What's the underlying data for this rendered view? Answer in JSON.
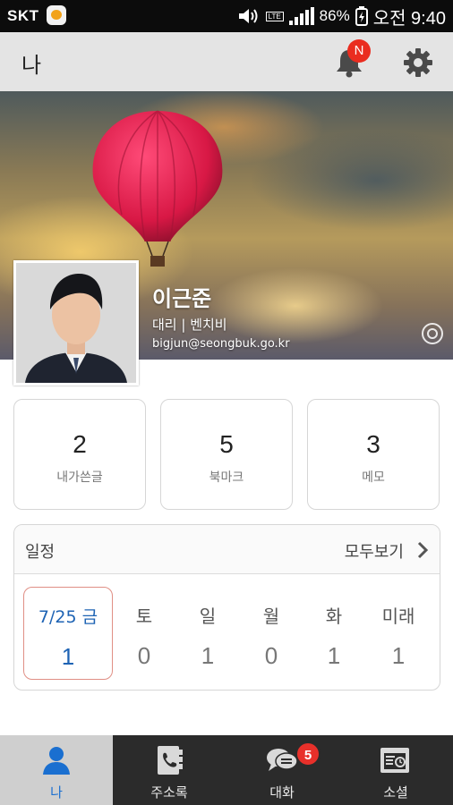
{
  "status_bar": {
    "carrier": "SKT",
    "network": "LTE",
    "battery_percent": "86%",
    "time": "오전 9:40",
    "icons": [
      "kakaotalk-icon",
      "volume-icon",
      "lte-icon",
      "signal-icon",
      "battery-charging-icon"
    ]
  },
  "app_bar": {
    "title": "나",
    "notification_badge": "N",
    "icons": [
      "bell-icon",
      "settings-gear-icon"
    ]
  },
  "profile": {
    "name": "이근준",
    "role": "대리 | 벤치비",
    "email": "bigjun@seongbuk.go.kr"
  },
  "stats": [
    {
      "count": "2",
      "label": "내가쓴글"
    },
    {
      "count": "5",
      "label": "북마크"
    },
    {
      "count": "3",
      "label": "메모"
    }
  ],
  "schedule": {
    "title": "일정",
    "see_all": "모두보기",
    "days": [
      {
        "label": "7/25  금",
        "count": "1",
        "today": true
      },
      {
        "label": "토",
        "count": "0"
      },
      {
        "label": "일",
        "count": "1"
      },
      {
        "label": "월",
        "count": "0"
      },
      {
        "label": "화",
        "count": "1"
      },
      {
        "label": "미래",
        "count": "1"
      }
    ]
  },
  "tab_bar": {
    "tabs": [
      {
        "label": "나",
        "icon": "person-icon",
        "active": true
      },
      {
        "label": "주소록",
        "icon": "address-book-icon"
      },
      {
        "label": "대화",
        "icon": "chat-bubble-icon",
        "badge": "5"
      },
      {
        "label": "소셜",
        "icon": "social-calendar-icon"
      }
    ]
  },
  "colors": {
    "accent_blue": "#1e63b4",
    "badge_red": "#ea2c1f",
    "tab_bar_bg": "#2b2b2b",
    "app_bar_bg": "#e4e4e4"
  }
}
